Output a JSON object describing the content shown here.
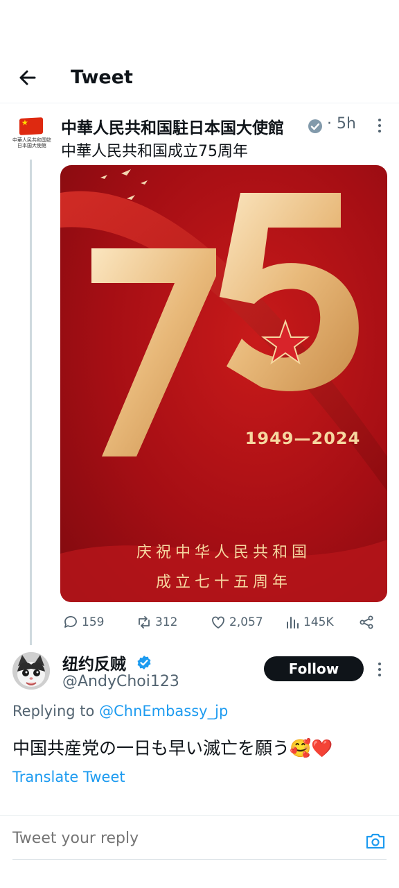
{
  "header": {
    "title": "Tweet",
    "back_icon": "arrow-left-icon"
  },
  "tweet": {
    "author_avatar_caption": "中華人民共和国駐日本国大使館",
    "author_name": "中華人民共和国駐日本国大使館",
    "time": "· 5h",
    "text": "中華人民共和国成立75周年",
    "image": {
      "big_number": "75",
      "years": "1949—2024",
      "line1": "庆祝中华人民共和国",
      "line2": "成立七十五周年"
    },
    "stats": {
      "replies": "159",
      "retweets": "312",
      "likes": "2,057",
      "views": "145K"
    }
  },
  "reply": {
    "name": "纽约反贼",
    "handle": "@AndyChoi123",
    "follow_label": "Follow",
    "replying_prefix": "Replying to",
    "replying_to": "@ChnEmbassy_jp",
    "text": "中国共産党の一日も早い滅亡を願う🥰❤️",
    "translate_label": "Translate Tweet"
  },
  "composer": {
    "placeholder": "Tweet your reply"
  },
  "colors": {
    "accent": "#1d9bf0",
    "poster_red": "#a50e14",
    "gold": "#f6d7a0"
  }
}
